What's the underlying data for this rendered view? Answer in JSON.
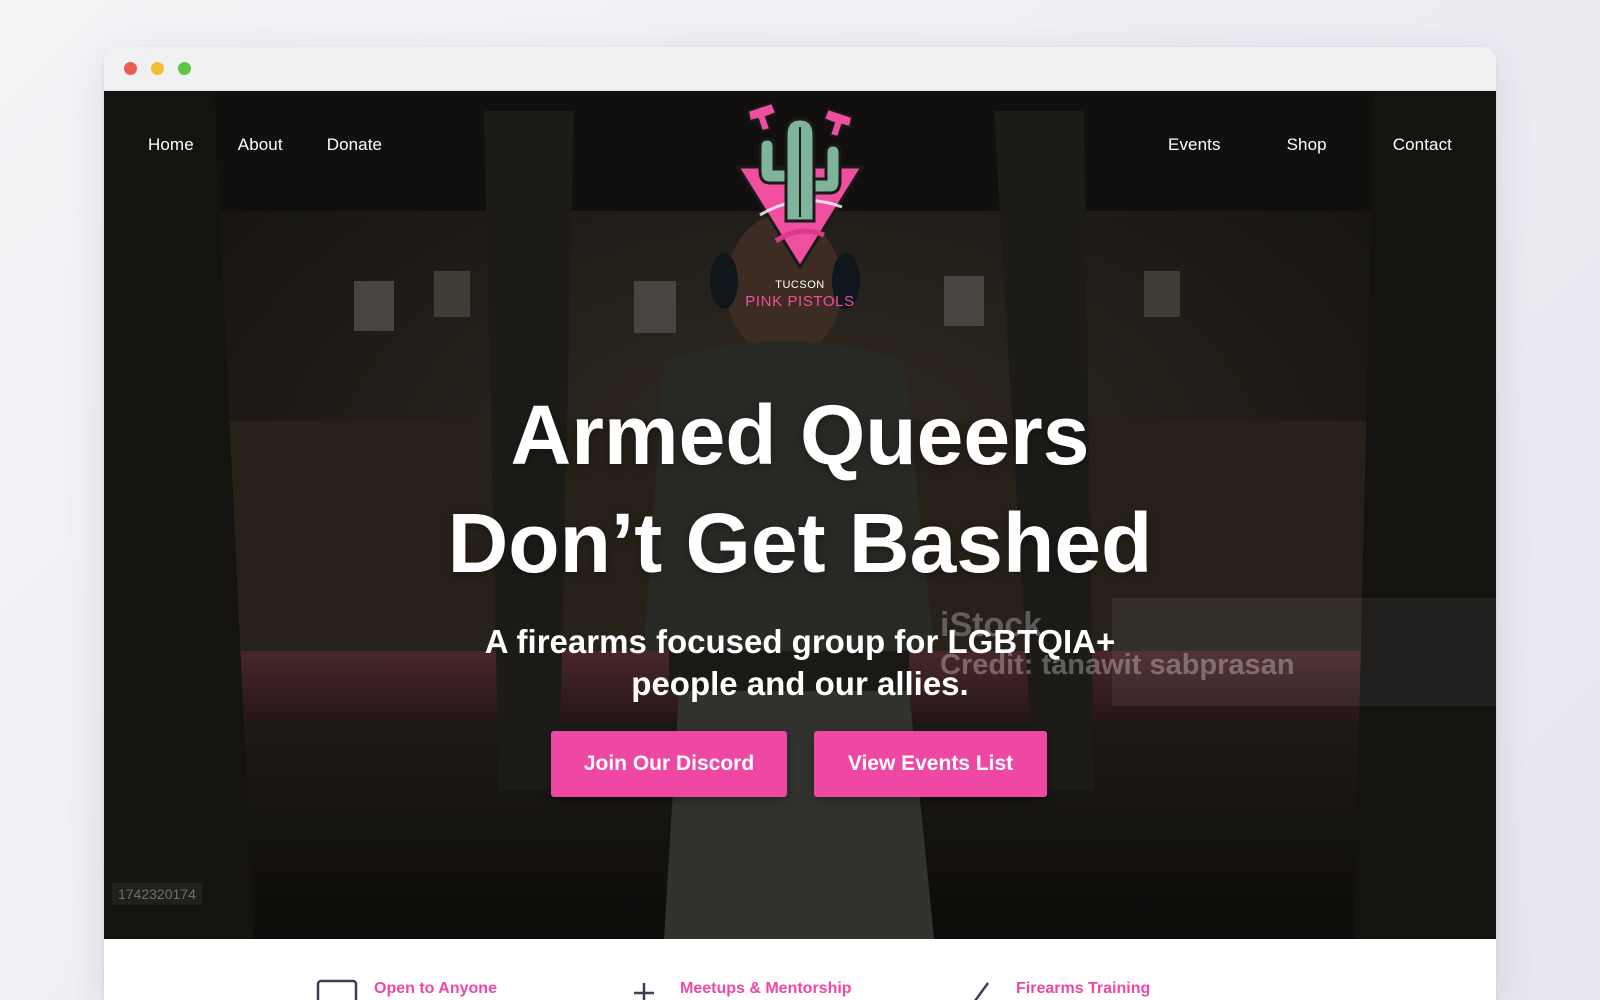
{
  "nav": {
    "left": [
      "Home",
      "About",
      "Donate"
    ],
    "right": [
      "Events",
      "Shop",
      "Contact"
    ]
  },
  "logo": {
    "small": "TUCSON",
    "big": "PINK PISTOLS"
  },
  "hero": {
    "headline_line1": "Armed Queers",
    "headline_line2": "Don’t Get Bashed",
    "sub_line1": "A firearms focused group for LGBTQIA+",
    "sub_line2": "people and our allies.",
    "watermark": "iStock",
    "watermark_credit": "Credit: tanawit sabprasan",
    "stock_id": "1742320174",
    "buttons": {
      "discord": "Join Our Discord",
      "events": "View Events List"
    }
  },
  "features": [
    {
      "label": "Open to Anyone",
      "icon": "card-icon"
    },
    {
      "label": "Meetups & Mentorship",
      "icon": "people-icon"
    },
    {
      "label": "Firearms Training",
      "icon": "target-icon"
    }
  ],
  "colors": {
    "accent": "#ef48a4",
    "logo_green": "#7fb39a",
    "logo_pink": "#f04fa0"
  }
}
